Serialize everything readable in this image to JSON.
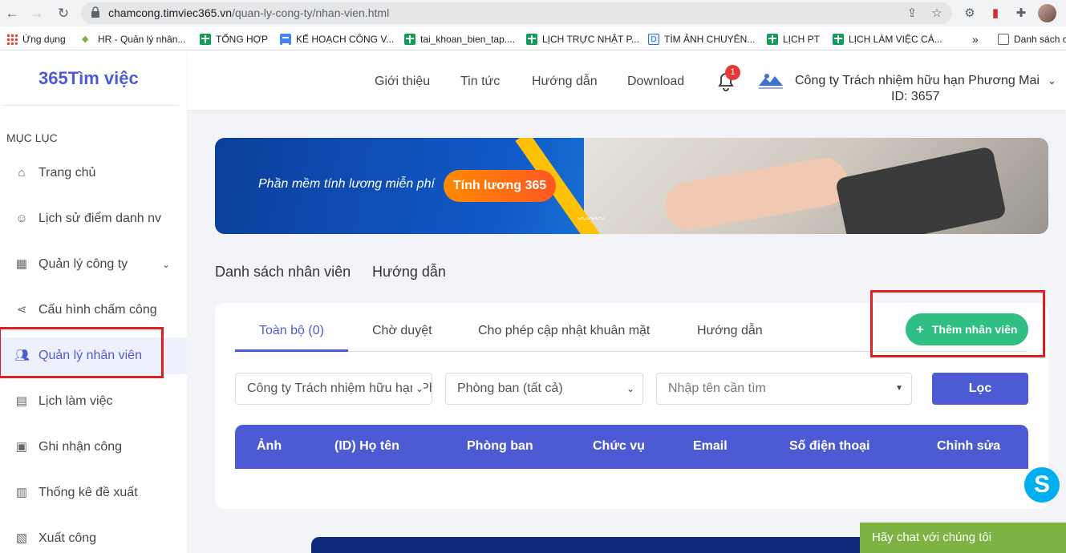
{
  "browser": {
    "url_host": "chamcong.timviec365.vn",
    "url_path": "/quan-ly-cong-ty/nhan-vien.html",
    "bookmarks": [
      {
        "label": "Ứng dụng",
        "icon": "apps-grid-icon"
      },
      {
        "label": "HR - Quản lý nhân...",
        "icon": "hr-icon"
      },
      {
        "label": "TỔNG HỢP",
        "icon": "sheets-icon"
      },
      {
        "label": "KẾ HOẠCH CÔNG V...",
        "icon": "docs-icon"
      },
      {
        "label": "tai_khoan_bien_tap....",
        "icon": "sheets-icon"
      },
      {
        "label": "LỊCH TRỰC NHẬT P...",
        "icon": "sheets-icon"
      },
      {
        "label": "TÌM ẢNH CHUYÊN...",
        "icon": "d-icon"
      },
      {
        "label": "LỊCH PT",
        "icon": "sheets-icon"
      },
      {
        "label": "LỊCH LÀM VIỆC CÁ...",
        "icon": "sheets-icon"
      }
    ],
    "more_label": "»",
    "reading_list_label": "Danh sách c"
  },
  "sidebar": {
    "logo_text": "365Tìm việc",
    "menu_title": "MỤC LỤC",
    "items": [
      {
        "label": "Trang chủ",
        "icon": "home-icon"
      },
      {
        "label": "Lịch sử điểm danh nv",
        "icon": "user-history-icon"
      },
      {
        "label": "Quản lý công ty",
        "icon": "building-icon"
      },
      {
        "label": "Cấu hình chấm công",
        "icon": "share-icon"
      },
      {
        "label": "Quản lý nhân viên",
        "icon": "users-icon",
        "active": true
      },
      {
        "label": "Lịch làm việc",
        "icon": "calendar-icon"
      },
      {
        "label": "Ghi nhận công",
        "icon": "record-icon"
      },
      {
        "label": "Thống kê đề xuất",
        "icon": "stats-icon"
      },
      {
        "label": "Xuất công",
        "icon": "export-icon"
      }
    ]
  },
  "topnav": {
    "links": [
      "Giới thiệu",
      "Tin tức",
      "Hướng dẫn",
      "Download"
    ],
    "notification_count": "1",
    "company_name": "Công ty Trách nhiệm hữu hạn Phương Mai",
    "company_id": "ID: 3657"
  },
  "banner": {
    "tagline": "Phần mềm tính lương miễn phí",
    "cta": "Tính lương 365"
  },
  "section_tabs": [
    "Danh sách nhân viên",
    "Hướng dẫn"
  ],
  "card": {
    "tabs": [
      "Toàn bộ (0)",
      "Chờ duyệt",
      "Cho phép cập nhật khuân mặt",
      "Hướng dẫn"
    ],
    "add_button": "Thêm nhân viên",
    "filters": {
      "company": "Công ty Trách nhiệm hữu hạn Phương Mai",
      "department": "Phòng ban (tất cả)",
      "search_placeholder": "Nhập tên cần tìm",
      "filter_button": "Lọc"
    },
    "columns": [
      "Ảnh",
      "(ID) Họ tên",
      "Phòng ban",
      "Chức vụ",
      "Email",
      "Số điện thoại",
      "Chỉnh sửa"
    ]
  },
  "chat_label": "Hãy chat với chúng tôi",
  "skype_label": "S",
  "colors": {
    "primary": "#4c5bd4",
    "green": "#2fbf82",
    "highlight": "#e02020",
    "chat": "#7cb342"
  }
}
